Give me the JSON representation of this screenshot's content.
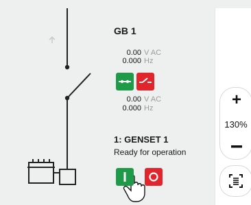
{
  "breaker": {
    "title": "GB 1",
    "top_voltage": "0.00",
    "top_voltage_unit": "V AC",
    "top_frequency": "0.000",
    "top_frequency_unit": "Hz",
    "bottom_voltage": "0.00",
    "bottom_voltage_unit": "V AC",
    "bottom_frequency": "0.000",
    "bottom_frequency_unit": "Hz",
    "close_button_icon": "breaker-closed-icon",
    "open_button_icon": "breaker-open-icon",
    "colors": {
      "close": "#1f9a48",
      "open": "#e0262c"
    }
  },
  "genset": {
    "title": "1: GENSET 1",
    "status": "Ready for operation",
    "start_button_icon": "start-icon",
    "stop_button_icon": "stop-icon"
  },
  "zoom": {
    "plus_label": "+",
    "level": "130%",
    "minus_icon": "minus-icon",
    "fit_icon": "fit-to-screen-icon"
  },
  "canvas": {
    "up_arrow_icon": "arrow-up-icon",
    "cursor_icon": "hand-pointer-icon"
  }
}
